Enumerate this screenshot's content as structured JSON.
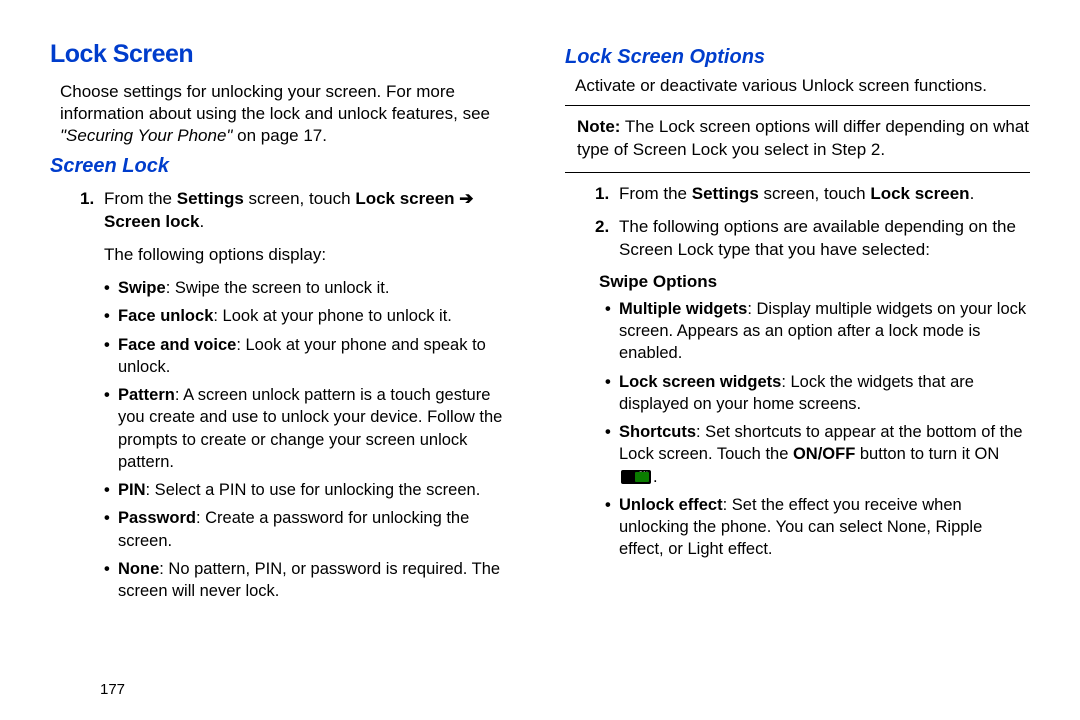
{
  "left": {
    "h1": "Lock Screen",
    "intro_p1": "Choose settings for unlocking your screen. For more information about using the lock and unlock features, see ",
    "intro_ref": "\"Securing Your Phone\"",
    "intro_p2": " on page 17.",
    "h2": "Screen Lock",
    "step1_num": "1.",
    "step1_a": "From the ",
    "step1_b": "Settings",
    "step1_c": " screen, touch ",
    "step1_d": "Lock screen",
    "step1_arrow": " ➔ ",
    "step1_e": "Screen lock",
    "step1_f": ".",
    "sub1": "The following options display:",
    "bullets": [
      {
        "b": "Swipe",
        "t": ": Swipe the screen to unlock it."
      },
      {
        "b": "Face unlock",
        "t": ": Look at your phone to unlock it."
      },
      {
        "b": "Face and voice",
        "t": ": Look at your phone and speak to unlock."
      },
      {
        "b": "Pattern",
        "t": ": A screen unlock pattern is a touch gesture you create and use to unlock your device. Follow the prompts to create or change your screen unlock pattern."
      },
      {
        "b": "PIN",
        "t": ": Select a PIN to use for unlocking the screen."
      },
      {
        "b": "Password",
        "t": ": Create a password for unlocking the screen."
      },
      {
        "b": "None",
        "t": ": No pattern, PIN, or password is required. The screen will never lock."
      }
    ]
  },
  "right": {
    "h2": "Lock Screen Options",
    "intro": "Activate or deactivate various Unlock screen functions.",
    "note_label": "Note:",
    "note_text": "The Lock screen options will differ depending on what type of Screen Lock you select in Step 2.",
    "step1_num": "1.",
    "step1_a": "From the ",
    "step1_b": "Settings",
    "step1_c": " screen, touch ",
    "step1_d": "Lock screen",
    "step1_e": ".",
    "step2_num": "2.",
    "step2_txt": "The following options are available depending on the Screen Lock type that you have selected:",
    "swipe_h": "Swipe Options",
    "bullets": [
      {
        "b": "Multiple widgets",
        "t": ": Display multiple widgets on your lock screen. Appears as an option after a lock mode is enabled."
      },
      {
        "b": "Lock screen widgets",
        "t": ": Lock the widgets that are displayed on your home screens."
      }
    ],
    "shortcuts_b": "Shortcuts",
    "shortcuts_t1": ": Set shortcuts to appear at the bottom of the Lock screen. Touch the ",
    "shortcuts_onoff": "ON/OFF",
    "shortcuts_t2": " button to turn it ON ",
    "toggle_label": "ON",
    "shortcuts_t3": ".",
    "unlock_b": "Unlock effect",
    "unlock_t": ": Set the effect you receive when unlocking the phone. You can select None, Ripple effect, or Light effect."
  },
  "page_number": "177"
}
